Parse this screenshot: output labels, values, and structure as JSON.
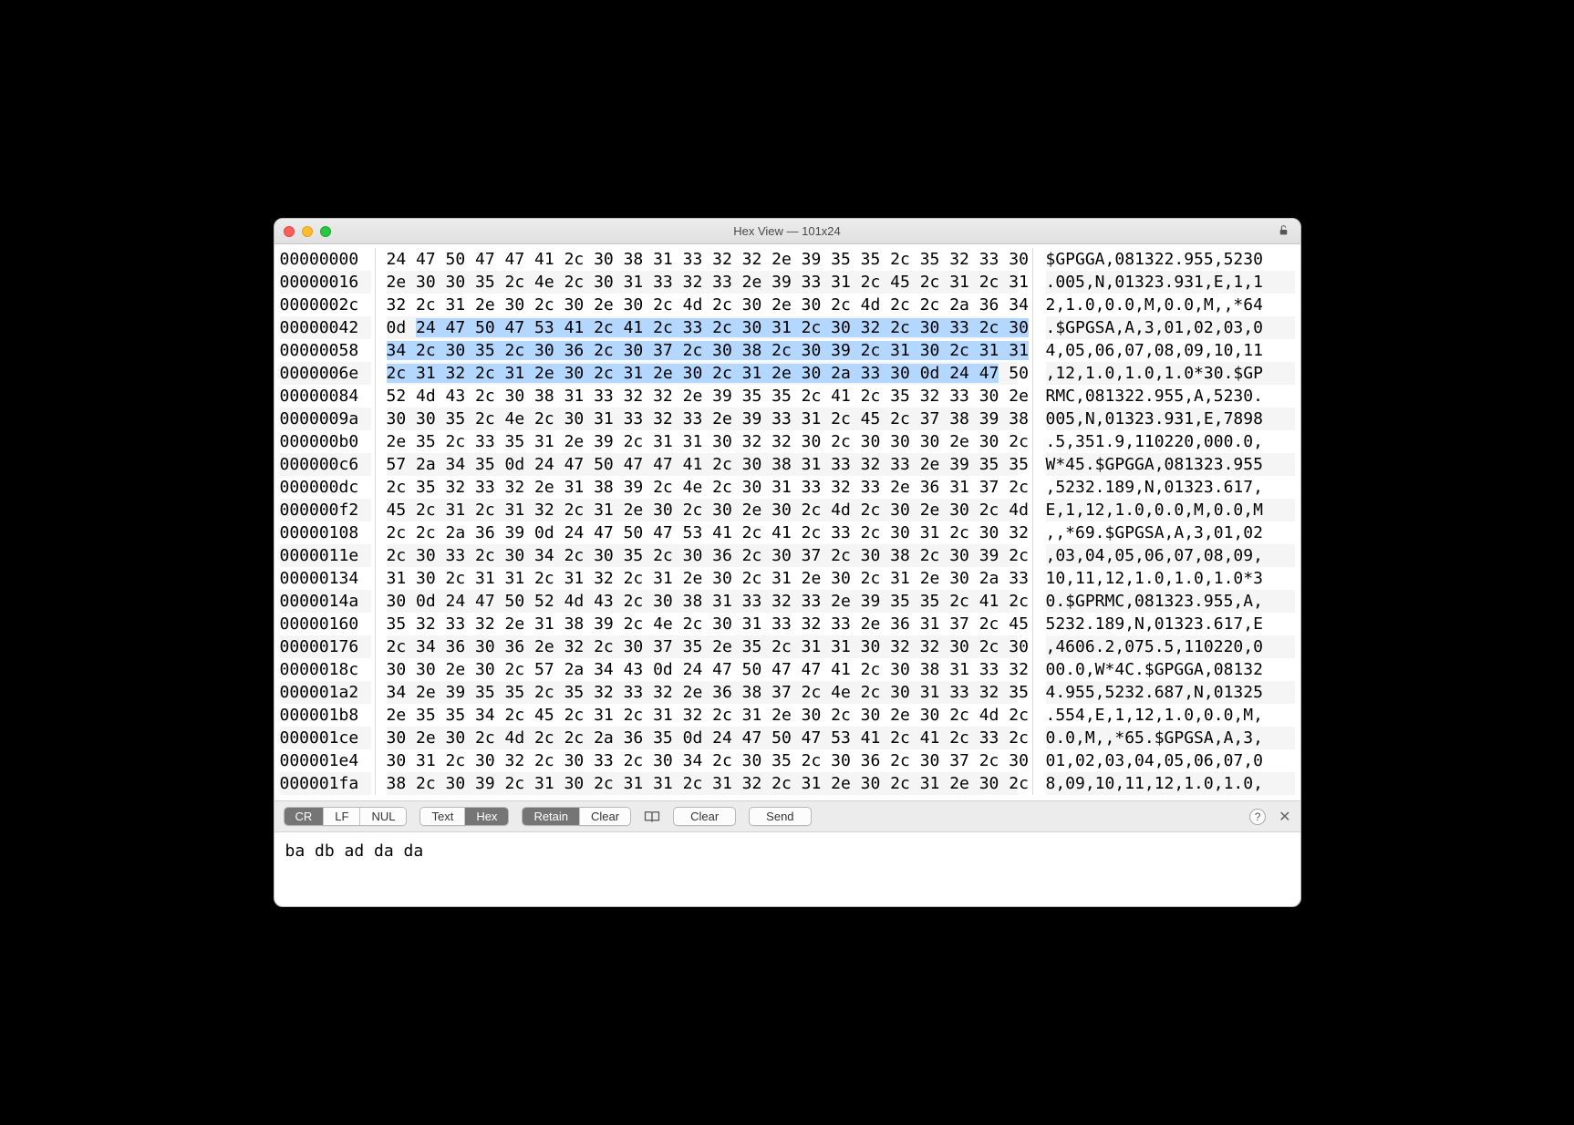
{
  "window": {
    "title": "Hex View — 101x24"
  },
  "toolbar": {
    "lineend": {
      "cr": "CR",
      "lf": "LF",
      "nul": "NUL",
      "active": "CR"
    },
    "mode": {
      "text": "Text",
      "hex": "Hex",
      "active": "Hex"
    },
    "retain": {
      "retain": "Retain",
      "clear": "Clear",
      "active": "Retain"
    },
    "clear_btn": "Clear",
    "send_btn": "Send"
  },
  "input": {
    "value": "ba db ad da da"
  },
  "hex": {
    "bytes_per_row": 22,
    "highlight": {
      "start": 67,
      "end": 130
    },
    "rows": [
      {
        "offset": "00000000",
        "hex": "24 47 50 47 47 41 2c 30 38 31 33 32 32 2e 39 35 35 2c 35 32 33 30",
        "ascii": "$GPGGA,081322.955,5230"
      },
      {
        "offset": "00000016",
        "hex": "2e 30 30 35 2c 4e 2c 30 31 33 32 33 2e 39 33 31 2c 45 2c 31 2c 31",
        "ascii": ".005,N,01323.931,E,1,1"
      },
      {
        "offset": "0000002c",
        "hex": "32 2c 31 2e 30 2c 30 2e 30 2c 4d 2c 30 2e 30 2c 4d 2c 2c 2a 36 34",
        "ascii": "2,1.0,0.0,M,0.0,M,,*64"
      },
      {
        "offset": "00000042",
        "hex": "0d 24 47 50 47 53 41 2c 41 2c 33 2c 30 31 2c 30 32 2c 30 33 2c 30",
        "ascii": ".$GPGSA,A,3,01,02,03,0"
      },
      {
        "offset": "00000058",
        "hex": "34 2c 30 35 2c 30 36 2c 30 37 2c 30 38 2c 30 39 2c 31 30 2c 31 31",
        "ascii": "4,05,06,07,08,09,10,11"
      },
      {
        "offset": "0000006e",
        "hex": "2c 31 32 2c 31 2e 30 2c 31 2e 30 2c 31 2e 30 2a 33 30 0d 24 47 50",
        "ascii": ",12,1.0,1.0,1.0*30.$GP"
      },
      {
        "offset": "00000084",
        "hex": "52 4d 43 2c 30 38 31 33 32 32 2e 39 35 35 2c 41 2c 35 32 33 30 2e",
        "ascii": "RMC,081322.955,A,5230."
      },
      {
        "offset": "0000009a",
        "hex": "30 30 35 2c 4e 2c 30 31 33 32 33 2e 39 33 31 2c 45 2c 37 38 39 38",
        "ascii": "005,N,01323.931,E,7898"
      },
      {
        "offset": "000000b0",
        "hex": "2e 35 2c 33 35 31 2e 39 2c 31 31 30 32 32 30 2c 30 30 30 2e 30 2c",
        "ascii": ".5,351.9,110220,000.0,"
      },
      {
        "offset": "000000c6",
        "hex": "57 2a 34 35 0d 24 47 50 47 47 41 2c 30 38 31 33 32 33 2e 39 35 35",
        "ascii": "W*45.$GPGGA,081323.955"
      },
      {
        "offset": "000000dc",
        "hex": "2c 35 32 33 32 2e 31 38 39 2c 4e 2c 30 31 33 32 33 2e 36 31 37 2c",
        "ascii": ",5232.189,N,01323.617,"
      },
      {
        "offset": "000000f2",
        "hex": "45 2c 31 2c 31 32 2c 31 2e 30 2c 30 2e 30 2c 4d 2c 30 2e 30 2c 4d",
        "ascii": "E,1,12,1.0,0.0,M,0.0,M"
      },
      {
        "offset": "00000108",
        "hex": "2c 2c 2a 36 39 0d 24 47 50 47 53 41 2c 41 2c 33 2c 30 31 2c 30 32",
        "ascii": ",,*69.$GPGSA,A,3,01,02"
      },
      {
        "offset": "0000011e",
        "hex": "2c 30 33 2c 30 34 2c 30 35 2c 30 36 2c 30 37 2c 30 38 2c 30 39 2c",
        "ascii": ",03,04,05,06,07,08,09,"
      },
      {
        "offset": "00000134",
        "hex": "31 30 2c 31 31 2c 31 32 2c 31 2e 30 2c 31 2e 30 2c 31 2e 30 2a 33",
        "ascii": "10,11,12,1.0,1.0,1.0*3"
      },
      {
        "offset": "0000014a",
        "hex": "30 0d 24 47 50 52 4d 43 2c 30 38 31 33 32 33 2e 39 35 35 2c 41 2c",
        "ascii": "0.$GPRMC,081323.955,A,"
      },
      {
        "offset": "00000160",
        "hex": "35 32 33 32 2e 31 38 39 2c 4e 2c 30 31 33 32 33 2e 36 31 37 2c 45",
        "ascii": "5232.189,N,01323.617,E"
      },
      {
        "offset": "00000176",
        "hex": "2c 34 36 30 36 2e 32 2c 30 37 35 2e 35 2c 31 31 30 32 32 30 2c 30",
        "ascii": ",4606.2,075.5,110220,0"
      },
      {
        "offset": "0000018c",
        "hex": "30 30 2e 30 2c 57 2a 34 43 0d 24 47 50 47 47 41 2c 30 38 31 33 32",
        "ascii": "00.0,W*4C.$GPGGA,08132"
      },
      {
        "offset": "000001a2",
        "hex": "34 2e 39 35 35 2c 35 32 33 32 2e 36 38 37 2c 4e 2c 30 31 33 32 35",
        "ascii": "4.955,5232.687,N,01325"
      },
      {
        "offset": "000001b8",
        "hex": "2e 35 35 34 2c 45 2c 31 2c 31 32 2c 31 2e 30 2c 30 2e 30 2c 4d 2c",
        "ascii": ".554,E,1,12,1.0,0.0,M,"
      },
      {
        "offset": "000001ce",
        "hex": "30 2e 30 2c 4d 2c 2c 2a 36 35 0d 24 47 50 47 53 41 2c 41 2c 33 2c",
        "ascii": "0.0,M,,*65.$GPGSA,A,3,"
      },
      {
        "offset": "000001e4",
        "hex": "30 31 2c 30 32 2c 30 33 2c 30 34 2c 30 35 2c 30 36 2c 30 37 2c 30",
        "ascii": "01,02,03,04,05,06,07,0"
      },
      {
        "offset": "000001fa",
        "hex": "38 2c 30 39 2c 31 30 2c 31 31 2c 31 32 2c 31 2e 30 2c 31 2e 30 2c",
        "ascii": "8,09,10,11,12,1.0,1.0,"
      }
    ]
  }
}
